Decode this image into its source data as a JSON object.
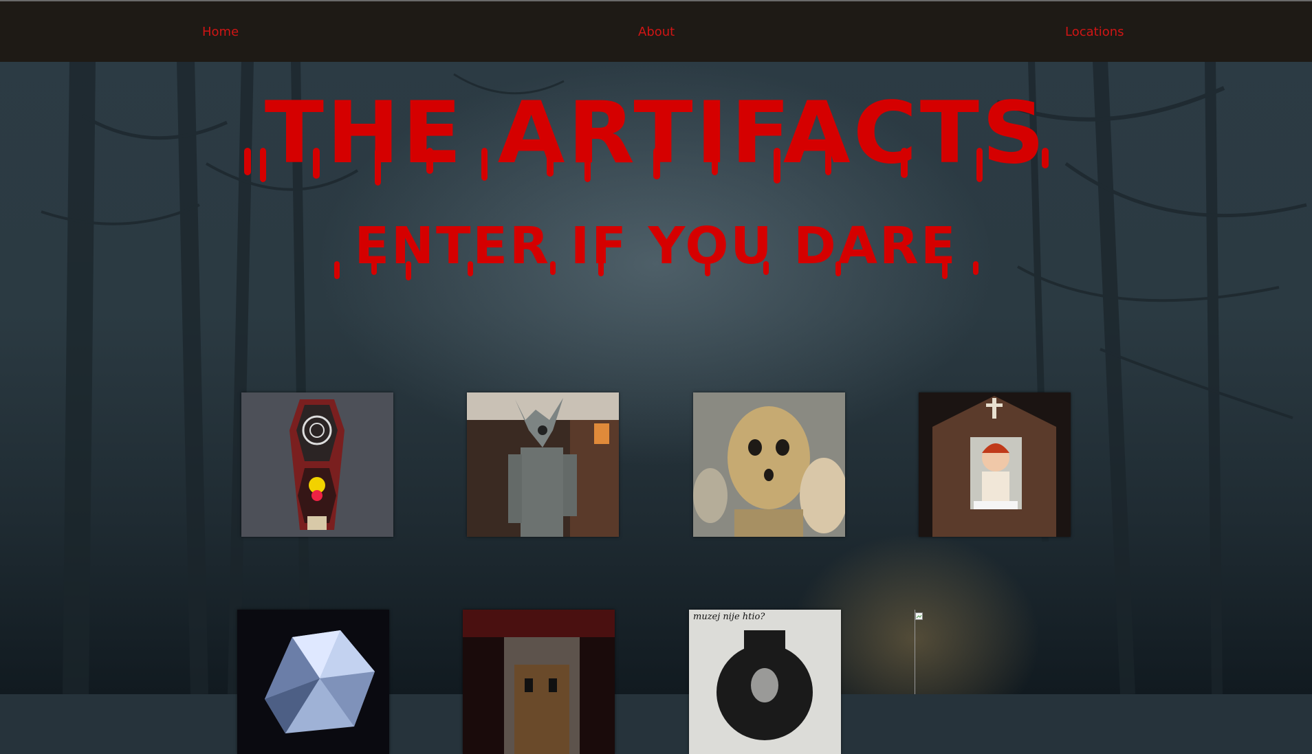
{
  "nav": {
    "home": "Home",
    "about": "About",
    "locations": "Locations"
  },
  "hero": {
    "title": "THE ARTIFACTS",
    "subtitle": "ENTER IF YOU DARE"
  },
  "gallery": {
    "row1": [
      "coffin-clown-box",
      "wooden-figure",
      "old-doll-heads",
      "annabelle-doll-case"
    ],
    "row2": [
      "crystal-gem",
      "glass-display-case",
      "newspaper-clipping",
      "broken-image"
    ],
    "newspaper_text": "muzej nije htio?"
  },
  "colors": {
    "accent": "#d50000",
    "navbar": "#1e1a15",
    "background": "#26333b"
  }
}
